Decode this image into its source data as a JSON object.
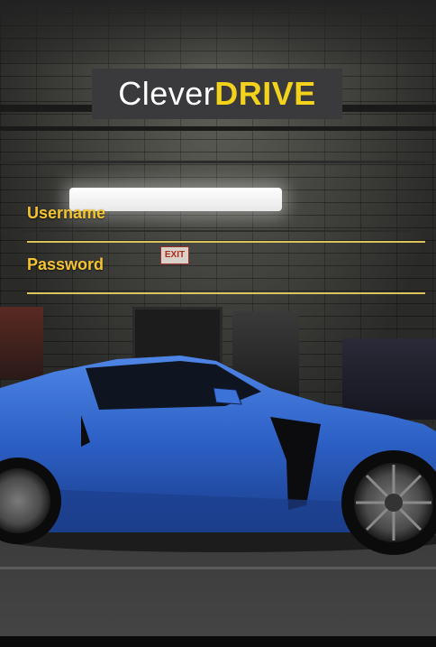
{
  "logo": {
    "part1": "Clever",
    "part2": "DRIVE"
  },
  "scene": {
    "exit_sign": "EXIT"
  },
  "login": {
    "username": {
      "label": "Username",
      "value": ""
    },
    "password": {
      "label": "Password",
      "value": ""
    }
  },
  "colors": {
    "accent": "#f4c430",
    "logo_yellow": "#f2d21a",
    "logo_bg": "#3a3a3c",
    "car_blue": "#2c5fc4"
  }
}
